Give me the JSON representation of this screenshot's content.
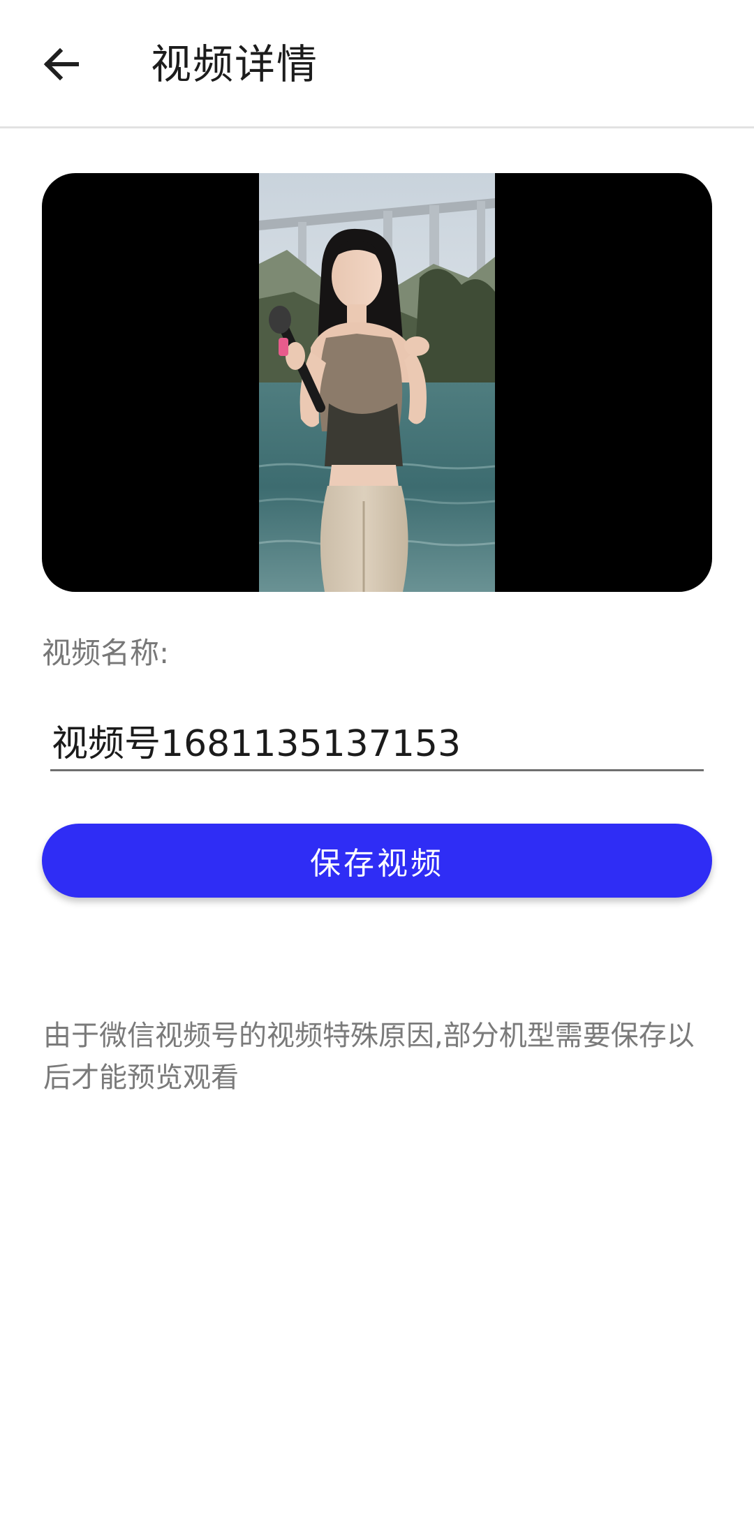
{
  "app_bar": {
    "title": "视频详情",
    "back_icon": "arrow-left-icon"
  },
  "video": {
    "preview_icon": "video-thumbnail"
  },
  "form": {
    "name_label": "视频名称:",
    "name_value": "视频号1681135137153"
  },
  "actions": {
    "save_label": "保存视频"
  },
  "notice": {
    "text": "由于微信视频号的视频特殊原因,部分机型需要保存以后才能预览观看"
  },
  "colors": {
    "accent": "#2f2df5",
    "video_background": "#000000",
    "muted_text": "#777777",
    "divider": "#e2e2e2"
  }
}
